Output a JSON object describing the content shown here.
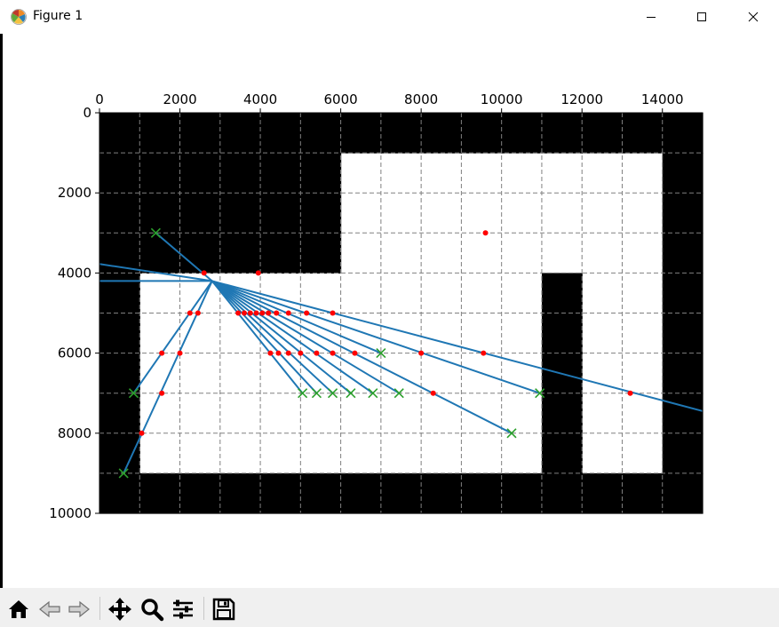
{
  "window": {
    "title": "Figure 1"
  },
  "icons": {
    "app": "matplotlib-logo-icon",
    "minimize": "minimize-icon",
    "maximize": "maximize-icon",
    "close": "close-icon",
    "home": "home-icon",
    "back": "back-arrow-icon",
    "forward": "forward-arrow-icon",
    "pan": "pan-move-icon",
    "zoom": "zoom-magnifier-icon",
    "configure": "configure-subplots-icon",
    "save": "save-floppy-icon"
  },
  "chart_data": {
    "type": "scatter",
    "xlim": [
      0,
      15000
    ],
    "ylim": [
      10000,
      0
    ],
    "x_ticks": [
      0,
      2000,
      4000,
      6000,
      8000,
      10000,
      12000,
      14000
    ],
    "y_ticks": [
      0,
      2000,
      4000,
      6000,
      8000,
      10000
    ],
    "x_tick_labels": [
      "0",
      "2000",
      "4000",
      "6000",
      "8000",
      "10000",
      "12000",
      "14000"
    ],
    "y_tick_labels": [
      "0",
      "2000",
      "4000",
      "6000",
      "8000",
      "10000"
    ],
    "x_axis_position": "top",
    "grid": true,
    "grid_step": 1000,
    "colors": {
      "obstacle": "#000000",
      "free": "#ffffff",
      "line": "#1f77b4",
      "hit": "#ff0000",
      "endpoint": "#2ca02c",
      "grid": "#808080"
    },
    "occupancy_grid": [
      "111111111111111",
      "111111000000001",
      "111111000000001",
      "111111000000001",
      "100000000001001",
      "100000000001001",
      "100000000001001",
      "100000000001001",
      "100000000001001",
      "111111111111111"
    ],
    "origin": [
      2800,
      4200
    ],
    "rays": [
      {
        "end": [
          -500,
          3700
        ]
      },
      {
        "end": [
          -500,
          4200
        ]
      },
      {
        "end": [
          1400,
          3000
        ]
      },
      {
        "end": [
          600,
          9000
        ]
      },
      {
        "end": [
          850,
          7000
        ]
      },
      {
        "end": [
          5050,
          7000
        ]
      },
      {
        "end": [
          5400,
          7000
        ]
      },
      {
        "end": [
          5800,
          7000
        ]
      },
      {
        "end": [
          6250,
          7000
        ]
      },
      {
        "end": [
          6800,
          7000
        ]
      },
      {
        "end": [
          7000,
          6000
        ]
      },
      {
        "end": [
          7450,
          7000
        ]
      },
      {
        "end": [
          10250,
          8000
        ]
      },
      {
        "end": [
          10950,
          7000
        ]
      },
      {
        "end": [
          15200,
          7500
        ]
      }
    ],
    "endpoint_markers": [
      [
        1400,
        3000
      ],
      [
        600,
        9000
      ],
      [
        850,
        7000
      ],
      [
        5050,
        7000
      ],
      [
        5400,
        7000
      ],
      [
        5800,
        7000
      ],
      [
        6250,
        7000
      ],
      [
        6800,
        7000
      ],
      [
        7000,
        6000
      ],
      [
        7450,
        7000
      ],
      [
        10250,
        8000
      ],
      [
        10950,
        7000
      ]
    ],
    "hit_points": [
      [
        2600,
        4000
      ],
      [
        3950,
        4000
      ],
      [
        9600,
        3000
      ],
      [
        2250,
        5000
      ],
      [
        2450,
        5000
      ],
      [
        3450,
        5000
      ],
      [
        3600,
        5000
      ],
      [
        3750,
        5000
      ],
      [
        3900,
        5000
      ],
      [
        4050,
        5000
      ],
      [
        4200,
        5000
      ],
      [
        4400,
        5000
      ],
      [
        4700,
        5000
      ],
      [
        5150,
        5000
      ],
      [
        5800,
        5000
      ],
      [
        1550,
        6000
      ],
      [
        2000,
        6000
      ],
      [
        4250,
        6000
      ],
      [
        4450,
        6000
      ],
      [
        4700,
        6000
      ],
      [
        5000,
        6000
      ],
      [
        5400,
        6000
      ],
      [
        5800,
        6000
      ],
      [
        6350,
        6000
      ],
      [
        8000,
        6000
      ],
      [
        9550,
        6000
      ],
      [
        1550,
        7000
      ],
      [
        8300,
        7000
      ],
      [
        13200,
        7000
      ],
      [
        1050,
        8000
      ]
    ]
  }
}
